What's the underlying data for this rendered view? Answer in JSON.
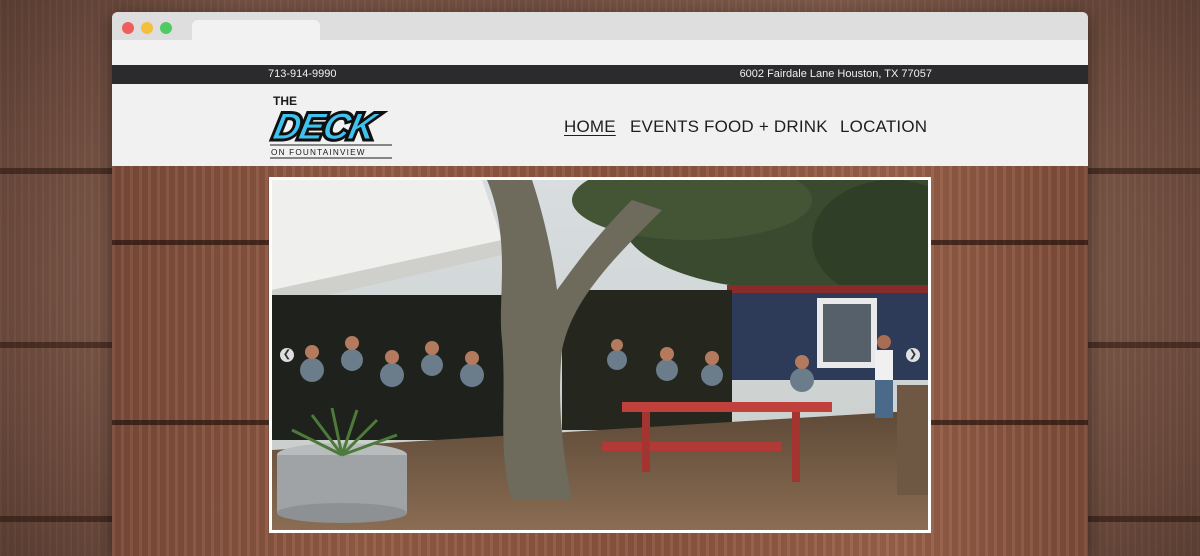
{
  "site": {
    "phone": "713-914-9990",
    "address": "6002 Fairdale Lane Houston, TX 77057"
  },
  "logo": {
    "line1": "THE",
    "line2": "DECK",
    "line3": "ON FOUNTAINVIEW"
  },
  "nav": {
    "items": [
      {
        "label": "HOME",
        "active": true
      },
      {
        "label": "EVENTS",
        "active": false
      },
      {
        "label": "FOOD + DRINK",
        "active": false
      },
      {
        "label": "LOCATION",
        "active": false
      }
    ]
  },
  "slider": {
    "prev_icon": "chevron-left-icon",
    "next_icon": "chevron-right-icon",
    "prev_glyph": "❮",
    "next_glyph": "❯"
  },
  "colors": {
    "topbar": "#2b2b2d",
    "header": "#f1f1f1",
    "logo_blue": "#3fc3ee",
    "logo_dark": "#1a1a1a"
  }
}
